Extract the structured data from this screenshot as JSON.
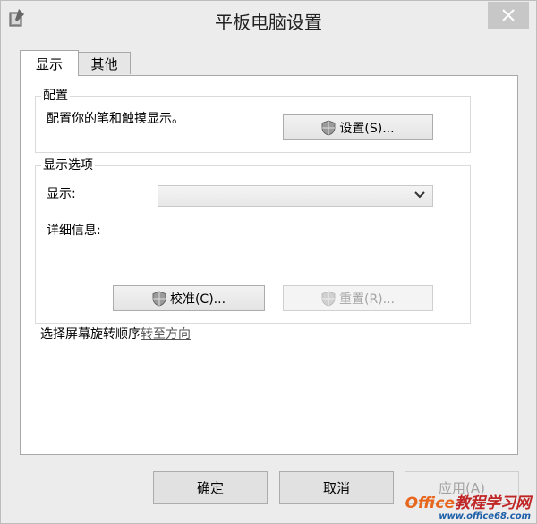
{
  "window": {
    "title": "平板电脑设置",
    "close_glyph": "✕"
  },
  "tabs": [
    {
      "label": "显示",
      "active": true
    },
    {
      "label": "其他",
      "active": false
    }
  ],
  "config_group": {
    "legend": "配置",
    "description": "配置你的笔和触摸显示。",
    "setup_button": "设置(S)..."
  },
  "display_options": {
    "legend": "显示选项",
    "display_label": "显示:",
    "display_value": "",
    "details_label": "详细信息:",
    "calibrate_button": "校准(C)...",
    "reset_button": "重置(R)..."
  },
  "rotation": {
    "text": "选择屏幕旋转顺序",
    "link": "转至方向"
  },
  "footer": {
    "ok": "确定",
    "cancel": "取消",
    "apply": "应用(A)"
  },
  "watermark": {
    "line1": "Office",
    "line1_cn": "教程学习网",
    "line2": "www.office68.com"
  },
  "colors": {
    "background": "#ececec",
    "panel": "#ffffff",
    "disabled_text": "#a3a3a3",
    "watermark_orange": "#e8671f",
    "watermark_blue": "#1d5fa8"
  }
}
